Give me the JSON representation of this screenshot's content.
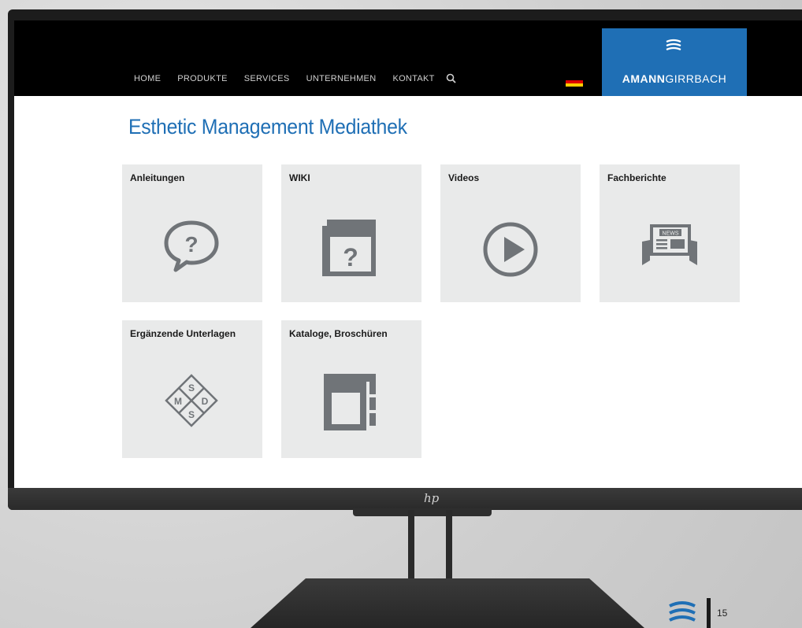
{
  "nav": {
    "items": [
      {
        "label": "HOME"
      },
      {
        "label": "PRODUKTE"
      },
      {
        "label": "SERVICES"
      },
      {
        "label": "UNTERNEHMEN"
      },
      {
        "label": "KONTAKT"
      }
    ],
    "search_icon": "search-icon",
    "language_flag": "flag-germany",
    "brand": {
      "name_bold": "AMANN",
      "name_regular": "GIRRBACH",
      "color": "#1f6fb5"
    }
  },
  "page": {
    "title": "Esthetic Management Mediathek",
    "accent": "#1f6fb5"
  },
  "tiles": [
    {
      "label": "Anleitungen",
      "icon": "question-speech-bubble-icon"
    },
    {
      "label": "WIKI",
      "icon": "wiki-book-icon"
    },
    {
      "label": "Videos",
      "icon": "play-icon"
    },
    {
      "label": "Fachberichte",
      "icon": "newspaper-icon",
      "icon_text": "NEWS"
    },
    {
      "label": "Ergänzende Unterlagen",
      "icon": "msds-diamond-icon",
      "icon_letters": [
        "S",
        "M",
        "D",
        "S"
      ]
    },
    {
      "label": "Kataloge, Broschüren",
      "icon": "catalog-binder-icon"
    }
  ],
  "device": {
    "brand_logo": "hp"
  },
  "footer": {
    "page_number": "15"
  }
}
